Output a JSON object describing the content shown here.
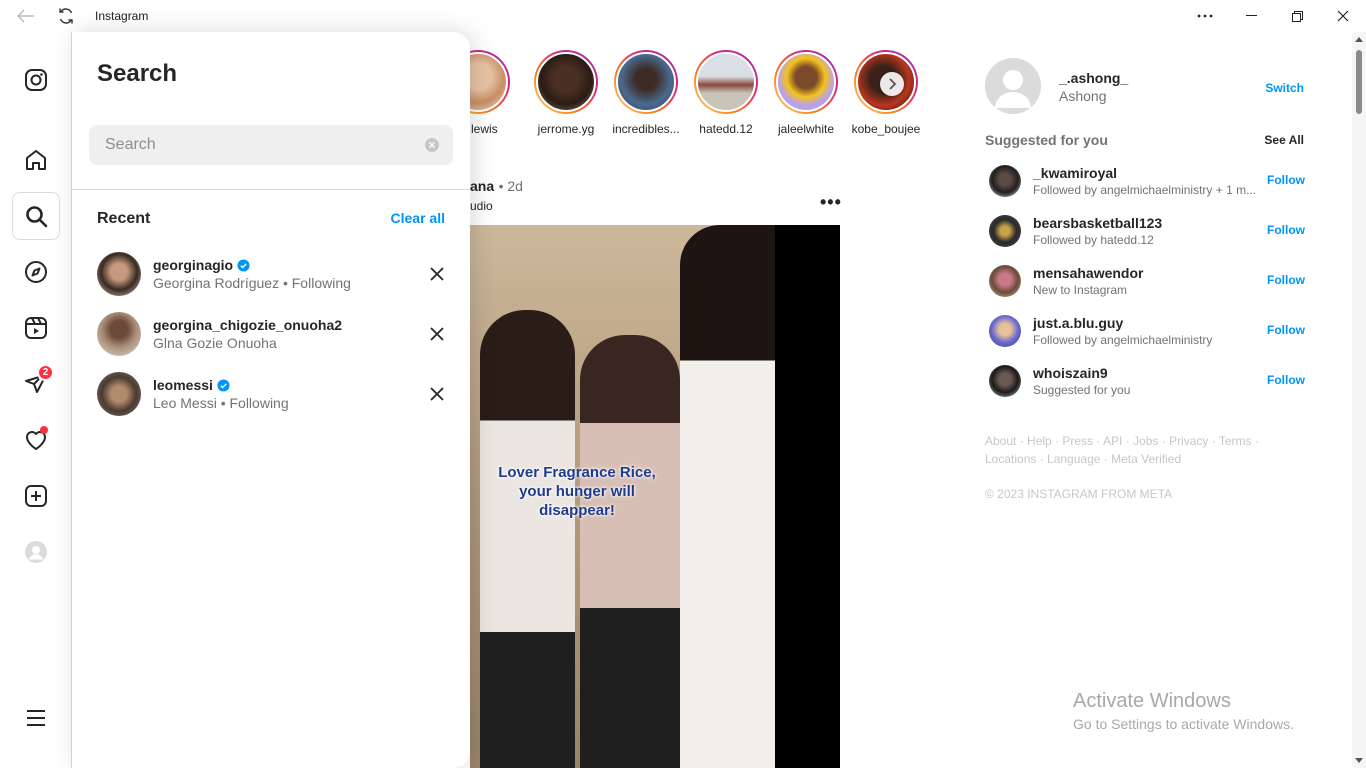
{
  "window": {
    "app_title": "Instagram"
  },
  "search_panel": {
    "title": "Search",
    "input_placeholder": "Search",
    "input_value": "",
    "recent_label": "Recent",
    "clear_all_label": "Clear all",
    "recent": [
      {
        "username": "georginagio",
        "verified": true,
        "subtitle": "Georgina Rodríguez • Following"
      },
      {
        "username": "georgina_chigozie_onuoha2",
        "verified": false,
        "subtitle": "Glna Gozie Onuoha"
      },
      {
        "username": "leomessi",
        "verified": true,
        "subtitle": "Leo Messi • Following"
      }
    ]
  },
  "nav": {
    "notifications_badge": "2"
  },
  "stories": [
    {
      "name": "ia.lewis"
    },
    {
      "name": "jerrome.yg"
    },
    {
      "name": "incredibles..."
    },
    {
      "name": "hatedd.12"
    },
    {
      "name": "jaleelwhite"
    },
    {
      "name": "kobe_boujee"
    }
  ],
  "post": {
    "username": "ana",
    "time": "• 2d",
    "audio": "udio",
    "more": "•••",
    "caption": "Lover Fragrance Rice, your hunger will disappear!"
  },
  "sidebar": {
    "me": {
      "username": "_.ashong_",
      "name": "Ashong",
      "switch_label": "Switch"
    },
    "suggested_label": "Suggested for you",
    "see_all_label": "See All",
    "suggestions": [
      {
        "username": "_kwamiroyal",
        "subtitle": "Followed by angelmichaelministry + 1 m...",
        "action": "Follow"
      },
      {
        "username": "bearsbasketball123",
        "subtitle": "Followed by hatedd.12",
        "action": "Follow"
      },
      {
        "username": "mensahawendor",
        "subtitle": "New to Instagram",
        "action": "Follow"
      },
      {
        "username": "just.a.blu.guy",
        "subtitle": "Followed by angelmichaelministry",
        "action": "Follow"
      },
      {
        "username": "whoiszain9",
        "subtitle": "Suggested for you",
        "action": "Follow"
      }
    ],
    "footer_links": "About · Help · Press · API · Jobs · Privacy · Terms · Locations · Language · Meta Verified",
    "copyright": "© 2023 INSTAGRAM FROM META"
  },
  "watermark": {
    "line1": "Activate Windows",
    "line2": "Go to Settings to activate Windows."
  },
  "colors": {
    "link_blue": "#0095f6",
    "badge_red": "#ff3040"
  }
}
